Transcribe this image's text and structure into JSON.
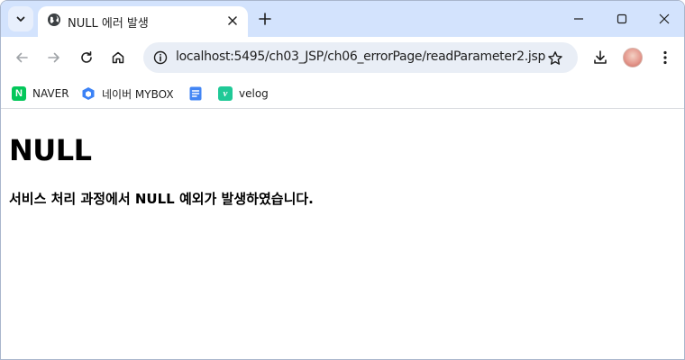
{
  "tab": {
    "title": "NULL 에러 발생"
  },
  "toolbar": {
    "url": "localhost:5495/ch03_JSP/ch06_errorPage/readParameter2.jsp"
  },
  "bookmarks": [
    {
      "label": "NAVER",
      "icon": "naver-icon"
    },
    {
      "label": "네이버 MYBOX",
      "icon": "mybox-icon"
    },
    {
      "label": "",
      "icon": "docs-icon"
    },
    {
      "label": "velog",
      "icon": "velog-icon"
    }
  ],
  "page": {
    "heading": "NULL",
    "message": "서비스 처리 과정에서 NULL 예외가 발생하였습니다."
  },
  "colors": {
    "tabstrip": "#d3e3fd",
    "omnibox": "#e9eef6",
    "naver": "#03c75a",
    "velog": "#20c997",
    "mybox": "#3b82f6",
    "docs": "#4285f4"
  }
}
